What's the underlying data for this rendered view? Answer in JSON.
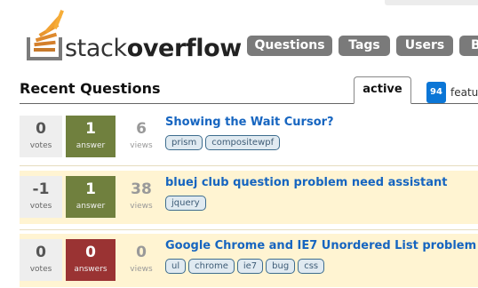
{
  "logo": {
    "brand_light": "stack",
    "brand_bold": "overflow"
  },
  "nav": [
    {
      "label": "Questions"
    },
    {
      "label": "Tags"
    },
    {
      "label": "Users"
    },
    {
      "label": "B"
    }
  ],
  "section": {
    "title": "Recent Questions",
    "active_tab": "active",
    "featured_count": "94",
    "featured_label": "featu"
  },
  "questions": [
    {
      "votes": "0",
      "votes_label": "votes",
      "answers": "1",
      "answers_label": "answer",
      "answer_state": "answered",
      "views": "6",
      "views_label": "views",
      "title": "Showing the Wait Cursor?",
      "tags": [
        "prism",
        "compositewpf"
      ]
    },
    {
      "votes": "-1",
      "votes_label": "votes",
      "answers": "1",
      "answers_label": "answer",
      "answer_state": "answered",
      "views": "38",
      "views_label": "views",
      "title": "bluej club question problem need assistant",
      "tags": [
        "jquery"
      ]
    },
    {
      "votes": "0",
      "votes_label": "votes",
      "answers": "0",
      "answers_label": "answers",
      "answer_state": "unanswered",
      "views": "0",
      "views_label": "views",
      "title": "Google Chrome and IE7 Unordered List problem",
      "tags": [
        "ul",
        "chrome",
        "ie7",
        "bug",
        "css"
      ]
    }
  ],
  "colors": {
    "answered": "#70803e",
    "unanswered": "#9a3333",
    "highlight_row": "#fff4d2",
    "title_link": "#1665c0",
    "nav_bg": "#7a7a7a",
    "featured_badge": "#0b76d6"
  }
}
